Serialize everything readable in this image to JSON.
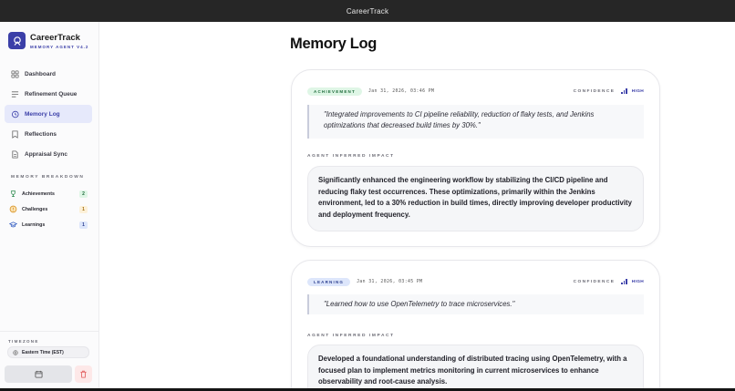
{
  "window": {
    "title": "CareerTrack"
  },
  "brand": {
    "name": "CareerTrack",
    "subtitle": "MEMORY AGENT V4.2"
  },
  "nav": [
    {
      "label": "Dashboard",
      "icon": "grid-icon",
      "active": false
    },
    {
      "label": "Refinement Queue",
      "icon": "list-icon",
      "active": false
    },
    {
      "label": "Memory Log",
      "icon": "history-icon",
      "active": true
    },
    {
      "label": "Reflections",
      "icon": "bookmark-icon",
      "active": false
    },
    {
      "label": "Appraisal Sync",
      "icon": "document-icon",
      "active": false
    }
  ],
  "breakdown": {
    "title": "MEMORY BREAKDOWN",
    "items": [
      {
        "label": "Achievements",
        "count": "2",
        "icon": "trophy-icon",
        "color": "#2e8b4f",
        "badge_bg": "#dff6e6"
      },
      {
        "label": "Challenges",
        "count": "1",
        "icon": "warning-icon",
        "color": "#d9962a",
        "badge_bg": "#fdf1d9"
      },
      {
        "label": "Learnings",
        "count": "1",
        "icon": "graduation-cap-icon",
        "color": "#3b63c4",
        "badge_bg": "#dde6fb"
      }
    ]
  },
  "timezone": {
    "label": "TIMEZONE",
    "value": "Eastern Time (EST)"
  },
  "main": {
    "title": "Memory Log"
  },
  "entries": [
    {
      "tag": "ACHIEVEMENT",
      "date": "Jan 31, 2026, 03:46 PM",
      "confidence_label": "CONFIDENCE",
      "confidence_level": "HIGH",
      "quote": "\"Integrated improvements to CI pipeline reliability, reduction of flaky tests, and Jenkins optimizations that decreased build times by 30%.\"",
      "impact_label": "AGENT INFERRED IMPACT",
      "impact": "Significantly enhanced the engineering workflow by stabilizing the CI/CD pipeline and reducing flaky test occurrences. These optimizations, primarily within the Jenkins environment, led to a 30% reduction in build times, directly improving developer productivity and deployment frequency."
    },
    {
      "tag": "LEARNING",
      "date": "Jan 31, 2026, 03:45 PM",
      "confidence_label": "CONFIDENCE",
      "confidence_level": "HIGH",
      "quote": "\"Learned how to use OpenTelemetry to trace microservices.\"",
      "impact_label": "AGENT INFERRED IMPACT",
      "impact": "Developed a foundational understanding of distributed tracing using OpenTelemetry, with a focused plan to implement metrics monitoring in current microservices to enhance observability and root-cause analysis."
    }
  ],
  "colors": {
    "accent": "#3b3fa8",
    "delete": "#e05555"
  }
}
